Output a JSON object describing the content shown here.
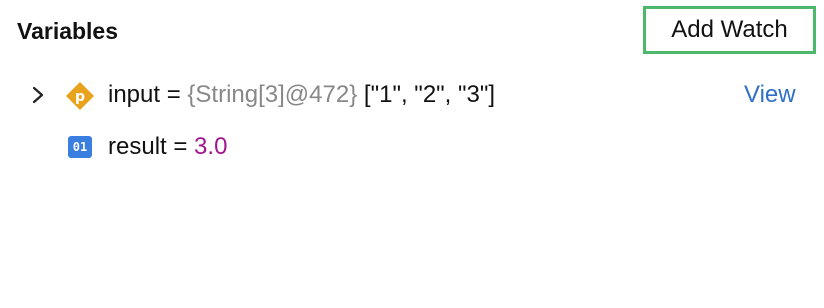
{
  "panel": {
    "title": "Variables",
    "add_watch_label": "Add Watch"
  },
  "variables": [
    {
      "name": "input",
      "equals": "=",
      "type_descriptor": "{String[3]@472}",
      "value": "[\"1\", \"2\", \"3\"]",
      "icon": "p",
      "expandable": true,
      "view_label": "View"
    },
    {
      "name": "result",
      "equals": "=",
      "value": "3.0",
      "icon": "01",
      "expandable": false
    }
  ],
  "colors": {
    "focus_border": "#4db86b",
    "icon_p": "#e8a21c",
    "icon_01": "#3a7fe0",
    "number_value": "#a0168e",
    "type_descriptor": "#888888",
    "link": "#2f6fc4"
  }
}
